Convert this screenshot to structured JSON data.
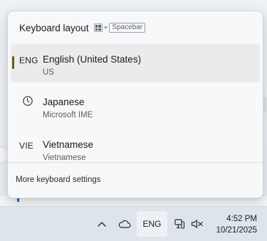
{
  "flyout": {
    "title": "Keyboard layout",
    "shortcut_key": "Spacebar",
    "shortcut_plus": "+",
    "items": [
      {
        "code": "ENG",
        "name": "English (United States)",
        "sub": "US",
        "selected": true
      },
      {
        "code": "",
        "icon": "ime-clock-icon",
        "name": "Japanese",
        "sub": "Microsoft IME",
        "selected": false
      },
      {
        "code": "VIE",
        "name": "Vietnamese",
        "sub": "Vietnamese",
        "selected": false
      }
    ],
    "more_link": "More keyboard settings",
    "accent_color": "#6b5f12"
  },
  "taskbar": {
    "lang": "ENG",
    "time": "4:52 PM",
    "date": "10/21/2025",
    "icons": [
      "chevron-up-icon",
      "cloud-icon",
      "network-icon",
      "volume-muted-icon"
    ]
  }
}
